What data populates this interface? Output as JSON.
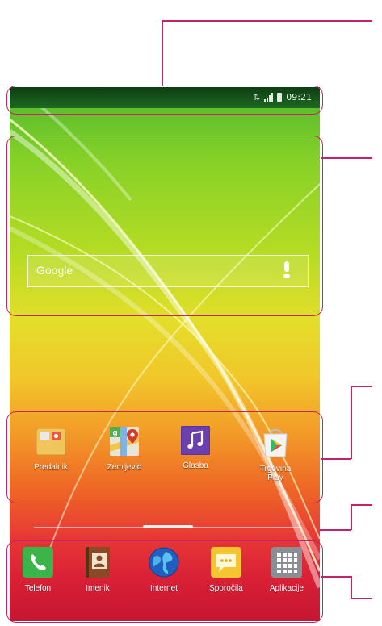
{
  "status_bar": {
    "time": "09:21"
  },
  "search_widget": {
    "logo_text": "Google"
  },
  "favorites": [
    {
      "label": "Predalnik"
    },
    {
      "label": "Zemljevid"
    },
    {
      "label": "Glasba"
    },
    {
      "label": "Trgovina Play"
    }
  ],
  "dock": [
    {
      "label": "Telefon"
    },
    {
      "label": "Imenik"
    },
    {
      "label": "Internet"
    },
    {
      "label": "Sporočila"
    },
    {
      "label": "Aplikacije"
    }
  ],
  "colors": {
    "callout": "#c4226d",
    "statusbar": "#1d6a22"
  }
}
